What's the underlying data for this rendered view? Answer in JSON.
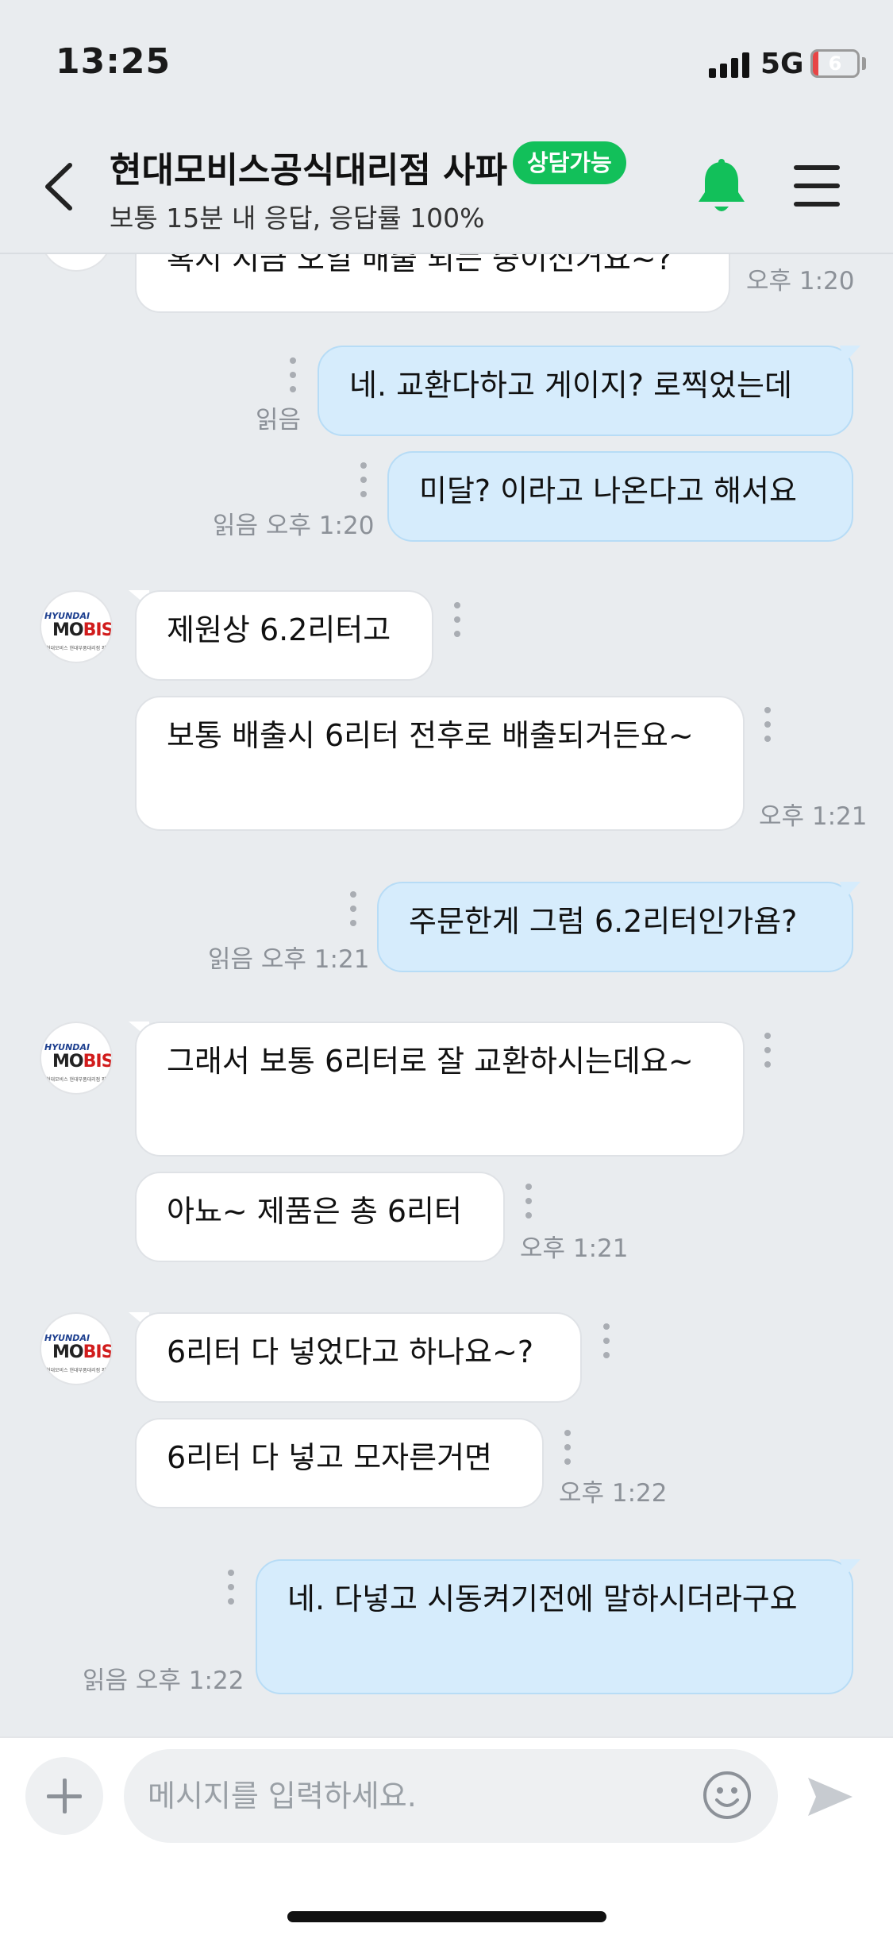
{
  "status_bar": {
    "time": "13:25",
    "network": "5G",
    "battery_level": "6",
    "battery_fraction": 0.06
  },
  "header": {
    "title": "현대모비스공식대리점 사파",
    "badge": "상담가능",
    "subtitle": "보통 15분 내 응답, 응답률 100%"
  },
  "messages": [
    {
      "sender": "agent",
      "text": "혹시 지금 오일 배출 되는 중이신거요~?",
      "time": "오후 1:20"
    },
    {
      "sender": "me",
      "text": "네. 교환다하고 게이지? 로찍었는데",
      "read": "읽음"
    },
    {
      "sender": "me",
      "text": "미달? 이라고 나온다고 해서요",
      "read": "읽음",
      "time": "오후 1:20"
    },
    {
      "sender": "agent",
      "text": "제원상 6.2리터고"
    },
    {
      "sender": "agent",
      "text": "보통 배출시 6리터 전후로 배출되거든요~",
      "time": "오후 1:21"
    },
    {
      "sender": "me",
      "text": "주문한게 그럼 6.2리터인가욤?",
      "read": "읽음",
      "time": "오후 1:21"
    },
    {
      "sender": "agent",
      "text": "그래서 보통 6리터로 잘 교환하시는데요~"
    },
    {
      "sender": "agent",
      "text": "아뇨~ 제품은 총 6리터",
      "time": "오후 1:21"
    },
    {
      "sender": "agent",
      "text": "6리터 다 넣었다고 하나요~?"
    },
    {
      "sender": "agent",
      "text": "6리터 다 넣고 모자른거면",
      "time": "오후 1:22"
    },
    {
      "sender": "me",
      "text": "네. 다넣고 시동켜기전에 말하시더라구요",
      "read": "읽음",
      "time": "오후 1:22"
    }
  ],
  "avatar": {
    "brand_top": "HYUNDAI",
    "brand_mo": "MO",
    "brand_bis": "BIS",
    "caption": "현대모비스 현대부품대리점 파사파"
  },
  "input": {
    "placeholder": "메시지를 입력하세요."
  },
  "colors": {
    "background": "#e9ecef",
    "outgoing_bubble": "#d6ecfc",
    "incoming_bubble": "#ffffff",
    "badge": "#12c05a",
    "bell": "#12c05a"
  }
}
